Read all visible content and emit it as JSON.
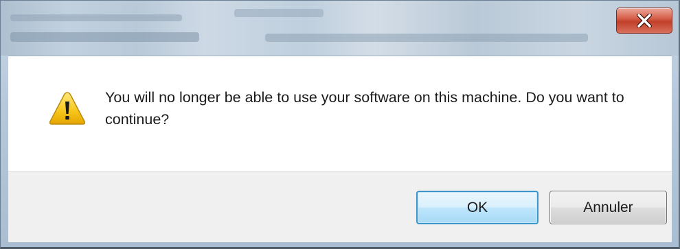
{
  "dialog": {
    "message": "You will no longer be able to use your software on this machine. Do you want to continue?",
    "icon": "warning-icon",
    "close_icon": "close-icon",
    "buttons": {
      "ok_label": "OK",
      "cancel_label": "Annuler"
    }
  },
  "colors": {
    "close_button": "#d0503a",
    "ok_border": "#3d95c9",
    "footer_background": "#f0f0f0",
    "warning_yellow": "#f5c400"
  }
}
